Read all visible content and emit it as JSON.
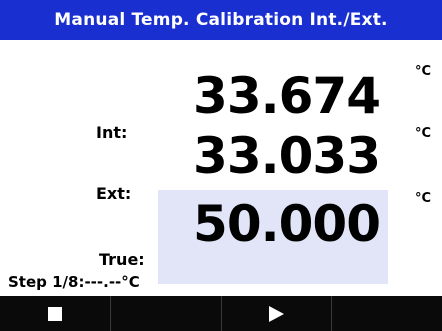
{
  "title": "Manual Temp. Calibration Int./Ext.",
  "readings": {
    "int": {
      "label": "Int:",
      "value": "33.674",
      "unit": "°C"
    },
    "ext": {
      "label": "Ext:",
      "value": "33.033",
      "unit": "°C"
    },
    "true": {
      "label": "True:",
      "value": "50.000",
      "unit": "°C"
    }
  },
  "step_text": "Step 1/8:---.--°C",
  "softkeys": [
    {
      "icon": "stop-icon"
    },
    {
      "icon": ""
    },
    {
      "icon": "play-icon"
    },
    {
      "icon": ""
    }
  ]
}
